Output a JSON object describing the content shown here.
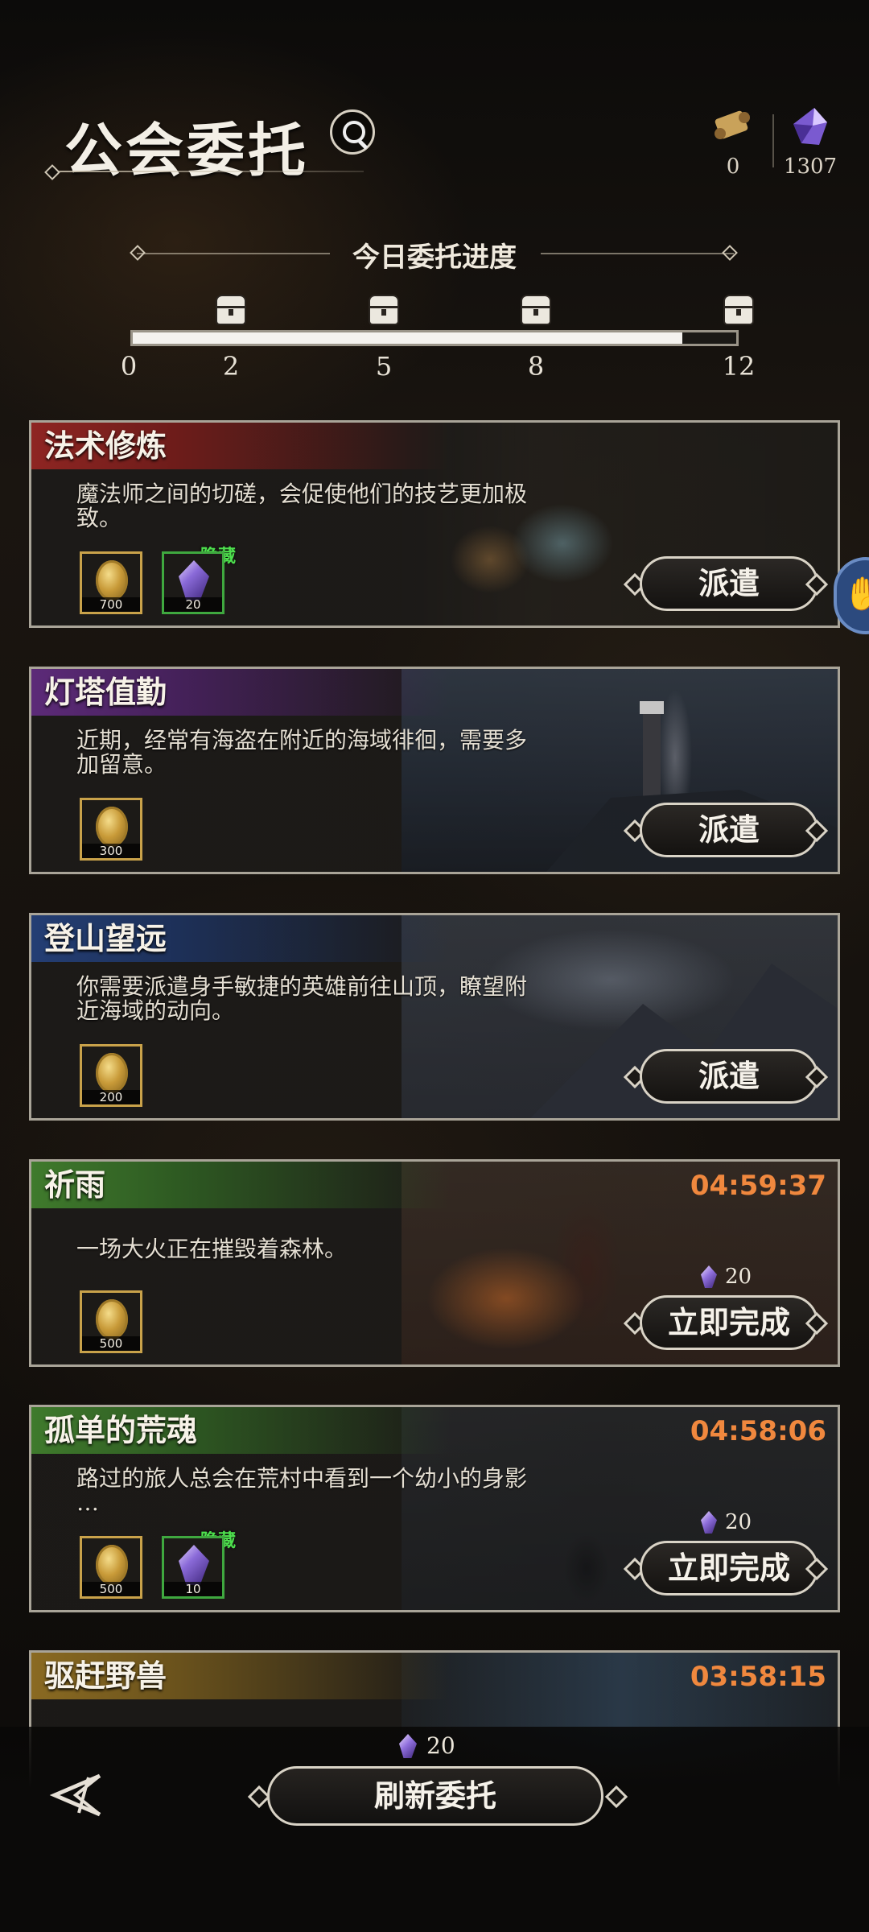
{
  "header": {
    "title": "公会委托",
    "resources": [
      {
        "icon": "scroll-icon",
        "value": "0"
      },
      {
        "icon": "crystal-icon",
        "value": "1307"
      }
    ]
  },
  "progress": {
    "label": "今日委托进度",
    "ticks": [
      "0",
      "2",
      "5",
      "8",
      "12"
    ],
    "current_fraction": 0.91
  },
  "quests": [
    {
      "title": "法术修炼",
      "desc_lines": [
        "魔法师之间的切磋，会促使他们的技艺更加极",
        "致。"
      ],
      "timer": "",
      "rewards": [
        {
          "type": "coin",
          "qty": "700",
          "hidden": ""
        },
        {
          "type": "gem",
          "qty": "20",
          "hidden": "隐藏"
        }
      ],
      "cost": "",
      "action": "派遣"
    },
    {
      "title": "灯塔值勤",
      "desc_lines": [
        "近期，经常有海盗在附近的海域徘徊，需要多",
        "加留意。"
      ],
      "timer": "",
      "rewards": [
        {
          "type": "coin",
          "qty": "300",
          "hidden": ""
        }
      ],
      "cost": "",
      "action": "派遣"
    },
    {
      "title": "登山望远",
      "desc_lines": [
        "你需要派遣身手敏捷的英雄前往山顶，瞭望附",
        "近海域的动向。"
      ],
      "timer": "",
      "rewards": [
        {
          "type": "coin",
          "qty": "200",
          "hidden": ""
        }
      ],
      "cost": "",
      "action": "派遣"
    },
    {
      "title": "祈雨",
      "desc_lines": [
        "一场大火正在摧毁着森林。",
        ""
      ],
      "timer": "04:59:37",
      "rewards": [
        {
          "type": "coin",
          "qty": "500",
          "hidden": ""
        }
      ],
      "cost": "20",
      "action": "立即完成"
    },
    {
      "title": "孤单的荒魂",
      "desc_lines": [
        "路过的旅人总会在荒村中看到一个幼小的身影",
        "…"
      ],
      "timer": "04:58:06",
      "rewards": [
        {
          "type": "coin",
          "qty": "500",
          "hidden": ""
        },
        {
          "type": "gem",
          "qty": "10",
          "hidden": "隐藏"
        }
      ],
      "cost": "20",
      "action": "立即完成"
    },
    {
      "title": "驱赶野兽",
      "desc_lines": [
        "",
        ""
      ],
      "timer": "03:58:15",
      "rewards": [],
      "cost": "",
      "action": ""
    }
  ],
  "footer": {
    "refresh_cost": "20",
    "refresh_label": "刷新委托"
  },
  "colors": {
    "timer": "#f0883e",
    "hidden_tag": "#4ee04e",
    "title_red": "#8e2522",
    "title_purple": "#5c2a78",
    "title_blue": "#243e74",
    "title_green": "#3f7a2c",
    "title_gold": "#8a6a22"
  }
}
